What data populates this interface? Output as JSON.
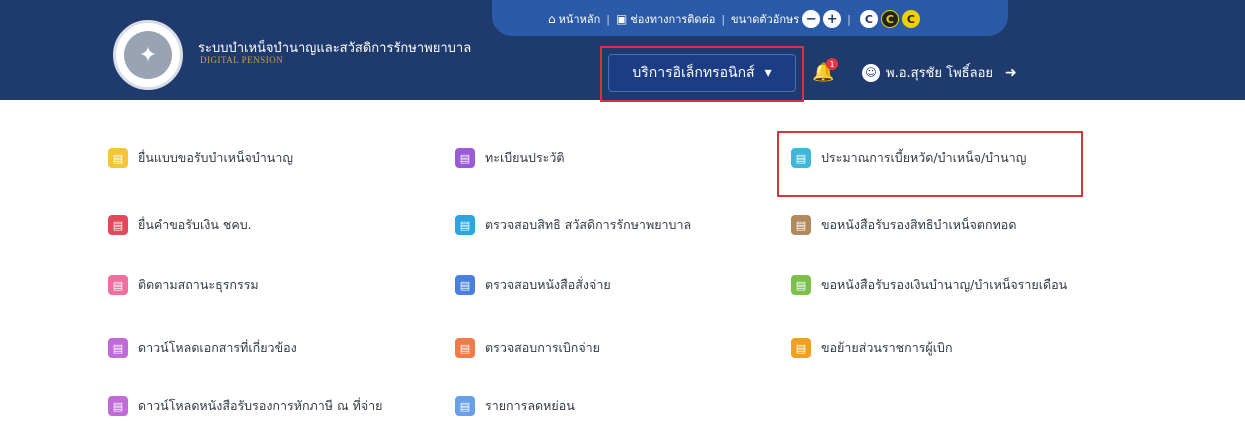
{
  "header": {
    "system_title": "ระบบบำเหน็จบำนาญและสวัสดิการรักษาพยาบาล",
    "system_subtitle": "DIGITAL PENSION",
    "topnav": {
      "home": "หน้าหลัก",
      "contact": "ช่องทางการติดต่อ",
      "font_size": "ขนาดตัวอักษร",
      "minus": "−",
      "plus": "+",
      "contrast": [
        "C",
        "C",
        "C"
      ]
    },
    "service_dropdown": "บริการอิเล็กทรอนิกส์",
    "notification_count": "1",
    "user_name": "พ.อ.สุรชัย โพธิ์ลอย"
  },
  "menu": {
    "col1": [
      {
        "label": "ยื่นแบบขอรับบำเหน็จบำนาญ",
        "color": "#f2c53a",
        "icon": "form-icon"
      },
      {
        "label": "ยื่นคำขอรับเงิน ชคบ.",
        "color": "#e5485b",
        "icon": "money-request-icon"
      },
      {
        "label": "ติดตามสถานะธุรกรรม",
        "color": "#ef6fa0",
        "icon": "tracking-icon"
      },
      {
        "label": "ดาวน์โหลดเอกสารที่เกี่ยวข้อง",
        "color": "#c06bd8",
        "icon": "download-icon"
      },
      {
        "label": "ดาวน์โหลดหนังสือรับรองการหักภาษี ณ ที่จ่าย",
        "color": "#c06bd8",
        "icon": "download-tax-icon"
      }
    ],
    "col2": [
      {
        "label": "ทะเบียนประวัติ",
        "color": "#9a5bd8",
        "icon": "profile-icon"
      },
      {
        "label": "ตรวจสอบสิทธิ สวัสดิการรักษาพยาบาล",
        "color": "#2aa6e0",
        "icon": "medical-rights-icon"
      },
      {
        "label": "ตรวจสอบหนังสือสั่งจ่าย",
        "color": "#4a7fe0",
        "icon": "payment-order-icon"
      },
      {
        "label": "ตรวจสอบการเบิกจ่าย",
        "color": "#f07a4a",
        "icon": "disbursement-icon"
      },
      {
        "label": "รายการลดหย่อน",
        "color": "#6aa0e8",
        "icon": "deduction-icon"
      }
    ],
    "col3": [
      {
        "label": "ประมาณการเบี้ยหวัด/บำเหน็จ/บำนาญ",
        "color": "#3fb8d8",
        "icon": "estimate-icon"
      },
      {
        "label": "ขอหนังสือรับรองสิทธิบำเหน็จตกทอด",
        "color": "#b08a5e",
        "icon": "inheritance-cert-icon"
      },
      {
        "label": "ขอหนังสือรับรองเงินบำนาญ/บำเหน็จรายเดือน",
        "color": "#7cc04a",
        "icon": "pension-cert-icon"
      },
      {
        "label": "ขอย้ายส่วนราชการผู้เบิก",
        "color": "#f0a020",
        "icon": "transfer-agency-icon"
      }
    ]
  }
}
